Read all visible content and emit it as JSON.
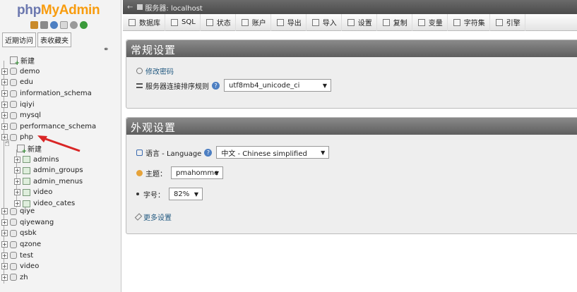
{
  "logo": {
    "php": "php",
    "my": "My",
    "admin": "Admin"
  },
  "nav": {
    "tabs": [
      "近期访问",
      "表收藏夹"
    ],
    "tree": [
      {
        "label": "新建",
        "kind": "new",
        "level": 0
      },
      {
        "label": "demo",
        "kind": "db",
        "level": 0
      },
      {
        "label": "edu",
        "kind": "db",
        "level": 0
      },
      {
        "label": "information_schema",
        "kind": "db",
        "level": 0
      },
      {
        "label": "iqiyi",
        "kind": "db",
        "level": 0
      },
      {
        "label": "mysql",
        "kind": "db",
        "level": 0
      },
      {
        "label": "performance_schema",
        "kind": "db",
        "level": 0
      },
      {
        "label": "php",
        "kind": "db",
        "level": 0
      },
      {
        "label": "新建",
        "kind": "new",
        "level": 1
      },
      {
        "label": "admins",
        "kind": "table",
        "level": 1
      },
      {
        "label": "admin_groups",
        "kind": "table",
        "level": 1
      },
      {
        "label": "admin_menus",
        "kind": "table",
        "level": 1
      },
      {
        "label": "video",
        "kind": "table",
        "level": 1
      },
      {
        "label": "video_cates",
        "kind": "table",
        "level": 1
      }
    ],
    "tree_lower": [
      {
        "label": "qiye",
        "kind": "db"
      },
      {
        "label": "qiyewang",
        "kind": "db"
      },
      {
        "label": "qsbk",
        "kind": "db"
      },
      {
        "label": "qzone",
        "kind": "db"
      },
      {
        "label": "test",
        "kind": "db"
      },
      {
        "label": "video",
        "kind": "db"
      },
      {
        "label": "zh",
        "kind": "db"
      }
    ]
  },
  "topbar": {
    "server_label": "服务器: localhost"
  },
  "toolbar": [
    "数据库",
    "SQL",
    "状态",
    "账户",
    "导出",
    "导入",
    "设置",
    "复制",
    "变量",
    "字符集",
    "引擎"
  ],
  "general": {
    "title": "常规设置",
    "change_password": "修改密码",
    "collation_label": "服务器连接排序规则",
    "collation_value": "utf8mb4_unicode_ci"
  },
  "appearance": {
    "title": "外观设置",
    "language_label": "语言 - Language",
    "language_value": "中文 - Chinese simplified",
    "theme_label": "主题：",
    "theme_value": "pmahomme",
    "fontsize_label": "字号：",
    "fontsize_value": "82%",
    "more_settings": "更多设置"
  },
  "colors": {
    "arrow": "#d92626",
    "php_blue": "#6c78af",
    "mya_orange": "#f89c0e"
  }
}
